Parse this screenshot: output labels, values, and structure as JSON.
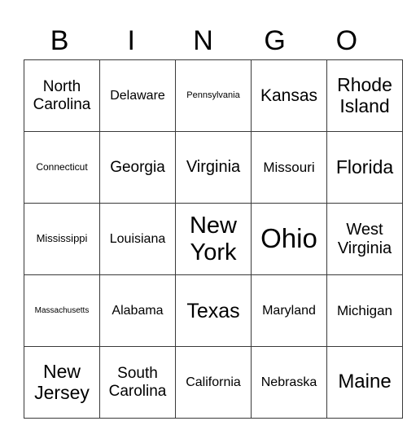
{
  "header": [
    "B",
    "I",
    "N",
    "G",
    "O"
  ],
  "rows": [
    [
      "North Carolina",
      "Delaware",
      "Pennsylvania",
      "Kansas",
      "Rhode Island"
    ],
    [
      "Connecticut",
      "Georgia",
      "Virginia",
      "Missouri",
      "Florida"
    ],
    [
      "Mississippi",
      "Louisiana",
      "New York",
      "Ohio",
      "West Virginia"
    ],
    [
      "Massachusetts",
      "Alabama",
      "Texas",
      "Maryland",
      "Michigan"
    ],
    [
      "New Jersey",
      "South Carolina",
      "California",
      "Nebraska",
      "Maine"
    ]
  ]
}
